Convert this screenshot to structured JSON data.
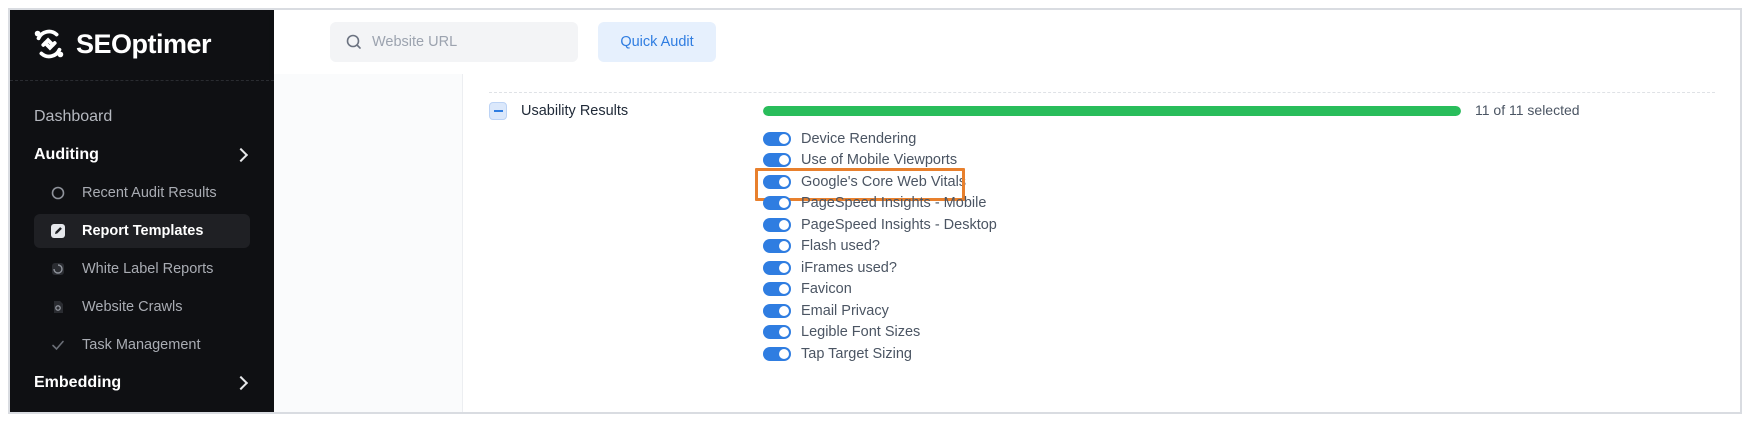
{
  "brand": {
    "name": "SEOptimer",
    "accent": "#2f7de1"
  },
  "sidebar": {
    "sections": [
      {
        "label": "Dashboard",
        "style": "muted"
      },
      {
        "label": "Auditing",
        "style": "bold",
        "expanded": true,
        "items": [
          {
            "label": "Recent Audit Results",
            "icon": "circle-icon",
            "active": false
          },
          {
            "label": "Report Templates",
            "icon": "template-edit-icon",
            "active": true
          },
          {
            "label": "White Label Reports",
            "icon": "report-icon",
            "active": false
          },
          {
            "label": "Website Crawls",
            "icon": "crawl-icon",
            "active": false
          },
          {
            "label": "Task Management",
            "icon": "check-icon",
            "active": false
          }
        ]
      },
      {
        "label": "Embedding",
        "style": "bold"
      }
    ]
  },
  "topbar": {
    "search_placeholder": "Website URL",
    "search_value": "",
    "quick_audit_label": "Quick Audit"
  },
  "usability": {
    "title": "Usability Results",
    "selected_text": "11 of 11 selected",
    "selected": 11,
    "total": 11,
    "progress_color": "#29bd5b",
    "options": [
      {
        "label": "Device Rendering",
        "enabled": true
      },
      {
        "label": "Use of Mobile Viewports",
        "enabled": true
      },
      {
        "label": "Google's Core Web Vitals",
        "enabled": true,
        "highlighted": true
      },
      {
        "label": "PageSpeed Insights - Mobile",
        "enabled": true
      },
      {
        "label": "PageSpeed Insights - Desktop",
        "enabled": true
      },
      {
        "label": "Flash used?",
        "enabled": true
      },
      {
        "label": "iFrames used?",
        "enabled": true
      },
      {
        "label": "Favicon",
        "enabled": true
      },
      {
        "label": "Email Privacy",
        "enabled": true
      },
      {
        "label": "Legible Font Sizes",
        "enabled": true
      },
      {
        "label": "Tap Target Sizing",
        "enabled": true
      }
    ]
  }
}
